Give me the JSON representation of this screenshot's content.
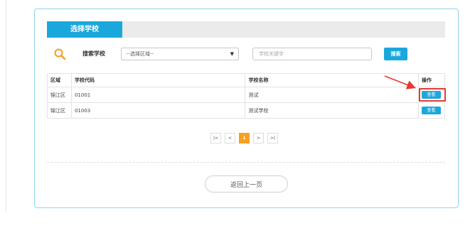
{
  "tab": {
    "label": "选择学校"
  },
  "search": {
    "label": "搜索学校",
    "region_select": "--选择区域--",
    "keyword_placeholder": "学校关键字",
    "button_label": "搜索"
  },
  "table": {
    "headers": [
      "区域",
      "学校代码",
      "学校名称",
      "操作"
    ],
    "rows": [
      {
        "region": "锦江区",
        "code": "01001",
        "name": "测试",
        "action": "查看"
      },
      {
        "region": "锦江区",
        "code": "01003",
        "name": "测试学校",
        "action": "查看"
      }
    ]
  },
  "pagination": {
    "first": "|<",
    "prev": "<",
    "current": "1",
    "next": ">",
    "last": ">|"
  },
  "back_button": "返回上一页",
  "colors": {
    "accent": "#1aa8dc",
    "active_page": "#f7a020",
    "highlight": "#e53935"
  }
}
